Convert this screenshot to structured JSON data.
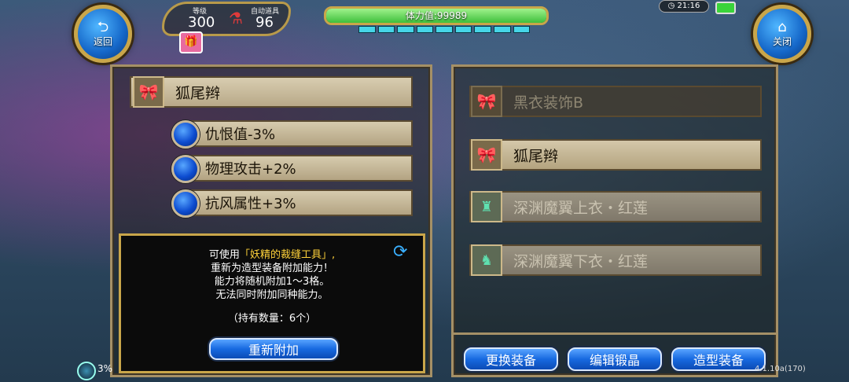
{
  "top_left": {
    "back_label": "返回",
    "back_icon": "return-arrow-icon"
  },
  "top_right": {
    "close_label": "关闭",
    "close_icon": "home-icon"
  },
  "status": {
    "level_label": "等级",
    "level_value": "300",
    "auto_item_label": "自动道具",
    "auto_item_value": "96",
    "stamina_label": "体力值:99989",
    "clock": "21:16"
  },
  "left_panel": {
    "item_name": "狐尾辫",
    "stats": [
      "仇恨值-3%",
      "物理攻击+2%",
      "抗风属性+3%"
    ]
  },
  "info_box": {
    "line1_prefix": "可使用",
    "line1_highlight": "「妖精的裁缝工具」,",
    "line2": "重新为造型装备附加能力！",
    "line3": "能力将随机附加1～3格。",
    "line4": "无法同时附加同种能力。",
    "count_text": "（持有数量：6个）",
    "reattach_button": "重新附加"
  },
  "right_panel": {
    "items": [
      {
        "name": "黑衣装饰B",
        "icon": "bow-ribbon-icon",
        "state": "dim"
      },
      {
        "name": "狐尾辫",
        "icon": "bow-ribbon-icon",
        "state": "selected"
      },
      {
        "name": "深渊魔翼上衣・红莲",
        "icon": "armor-top-icon",
        "state": "grey"
      },
      {
        "name": "深渊魔翼下衣・红莲",
        "icon": "armor-bottom-icon",
        "state": "grey"
      }
    ]
  },
  "bottom_buttons": {
    "change_equip": "更换装备",
    "edit_crystal": "编辑锻晶",
    "style_equip": "造型装备"
  },
  "footer": {
    "percent": "3%",
    "version": "4.1.10a(170)"
  },
  "colors": {
    "highlight": "#ffd23a",
    "stamina_green": "#4cd64a",
    "gold_border": "#b89a4a"
  }
}
